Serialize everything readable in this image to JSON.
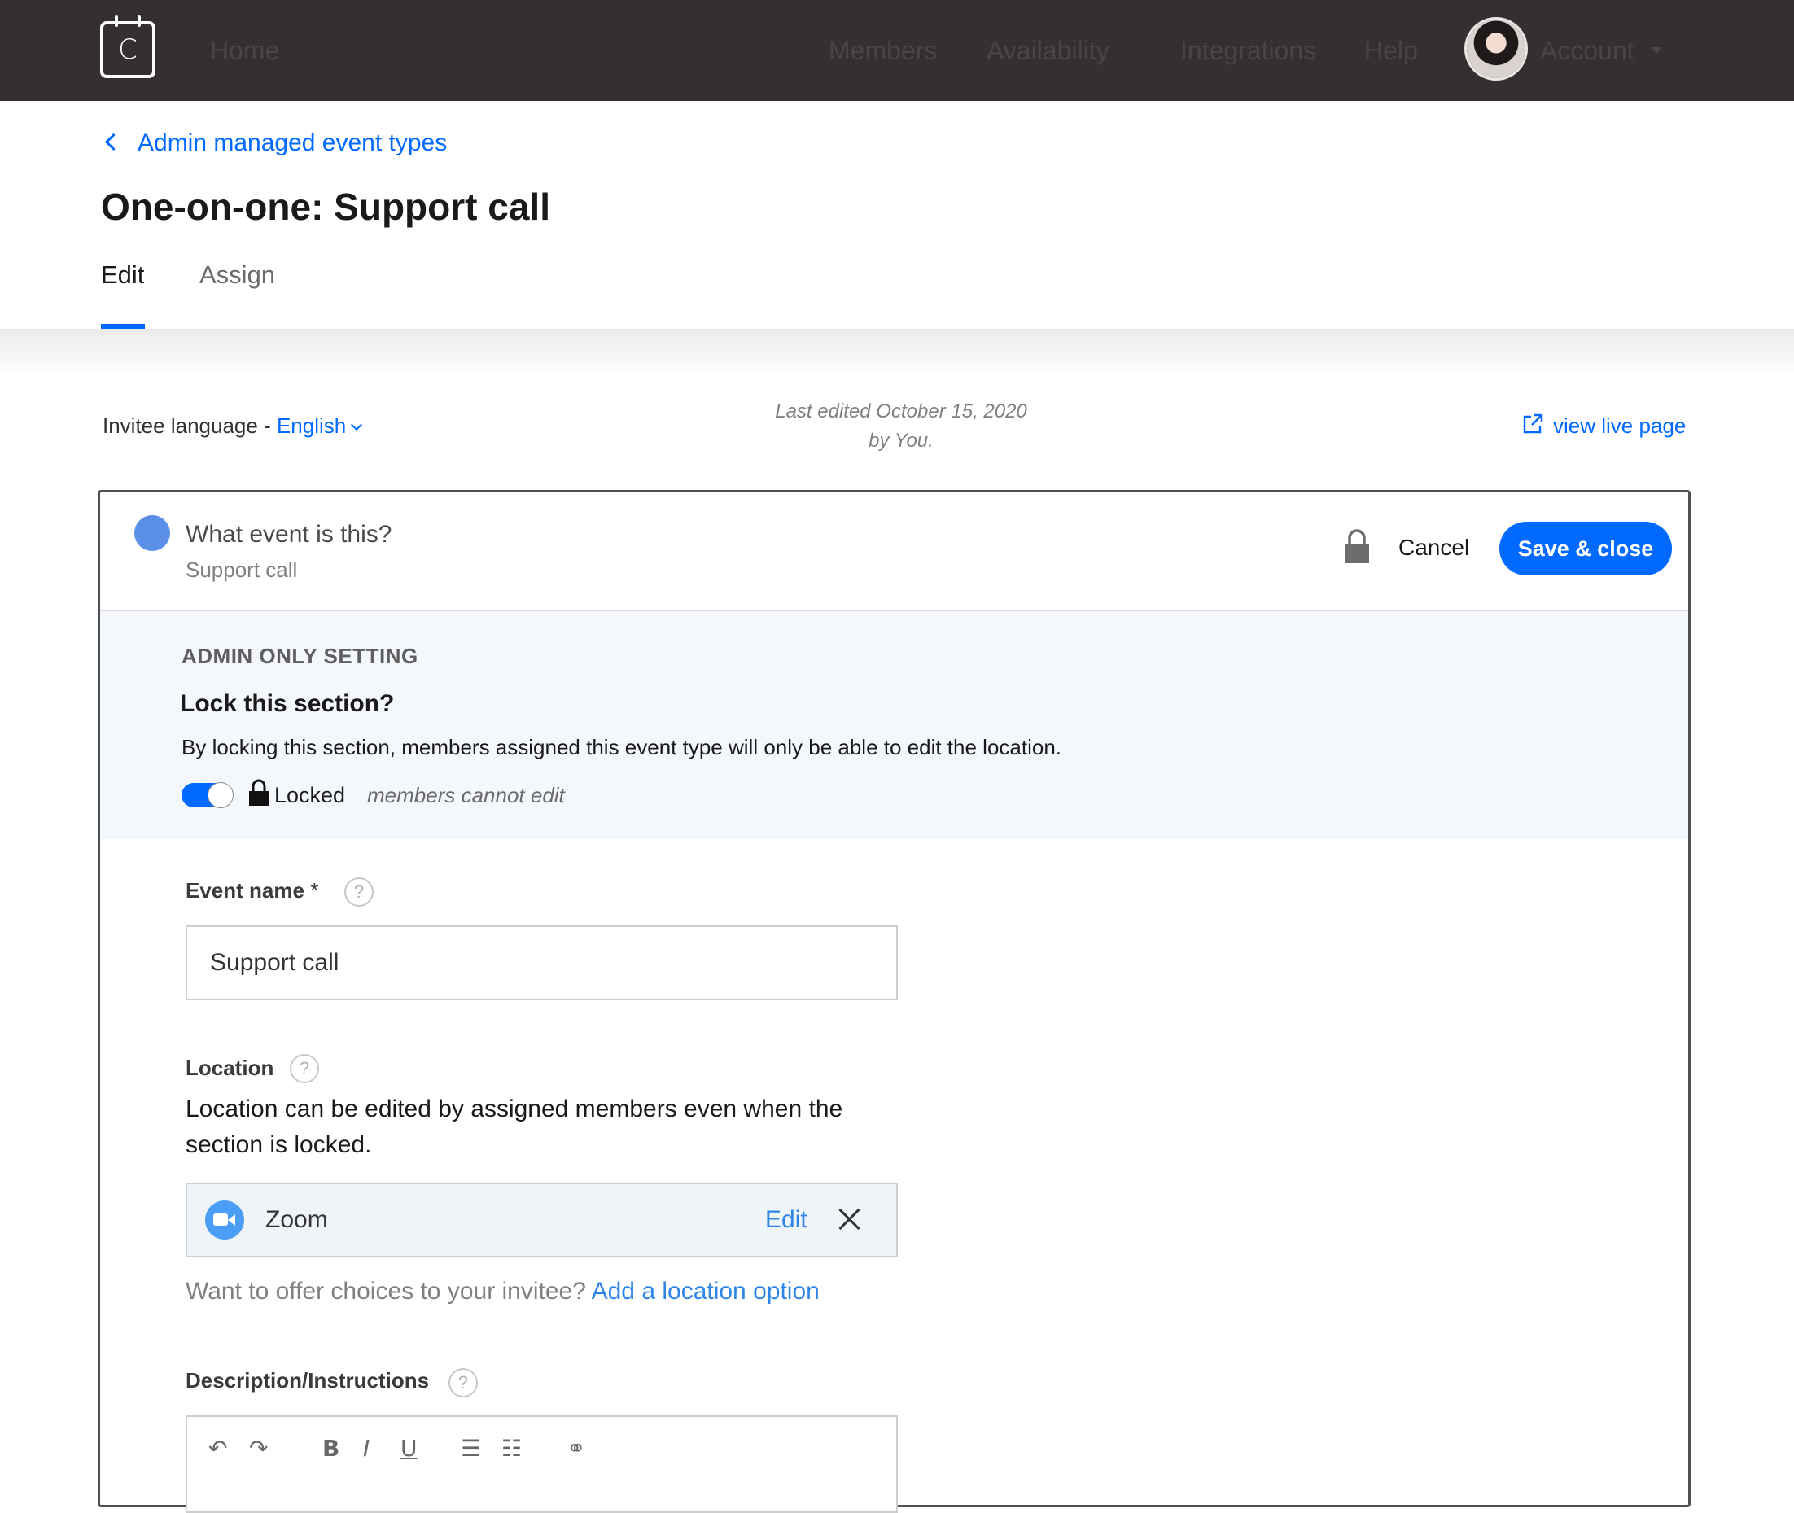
{
  "nav": {
    "logo_letter": "C",
    "home": "Home",
    "members": "Members",
    "availability": "Availability",
    "integrations": "Integrations",
    "help": "Help",
    "account": "Account"
  },
  "header": {
    "back_link": "Admin managed event types",
    "title": "One-on-one: Support call",
    "tabs": [
      {
        "label": "Edit",
        "active": true
      },
      {
        "label": "Assign",
        "active": false
      }
    ]
  },
  "meta": {
    "language_label": "Invitee language - ",
    "language_value": "English",
    "last_edited_line1": "Last edited October 15, 2020",
    "last_edited_line2": "by You.",
    "view_live": "view live page"
  },
  "card": {
    "question": "What event is this?",
    "subtitle": "Support call",
    "cancel": "Cancel",
    "save": "Save & close",
    "dot_color": "#5b8ee6",
    "admin": {
      "label": "ADMIN ONLY SETTING",
      "question": "Lock this section?",
      "description": "By locking this section, members assigned this event type will only be able to edit the location.",
      "toggle_on": true,
      "locked_text": "Locked",
      "locked_note": "members cannot edit"
    },
    "event_name": {
      "label": "Event name",
      "required_mark": "*",
      "value": "Support call"
    },
    "location": {
      "label": "Location",
      "help_text": "Location can be edited by assigned members even when the section is locked.",
      "selected": "Zoom",
      "edit": "Edit",
      "choices_text": "Want to offer choices to your invitee? ",
      "add_option": "Add a location option"
    },
    "description": {
      "label": "Description/Instructions"
    }
  },
  "colors": {
    "accent": "#0069ff",
    "nav_bg": "#362f31",
    "admin_bg": "#f4f8fd"
  }
}
